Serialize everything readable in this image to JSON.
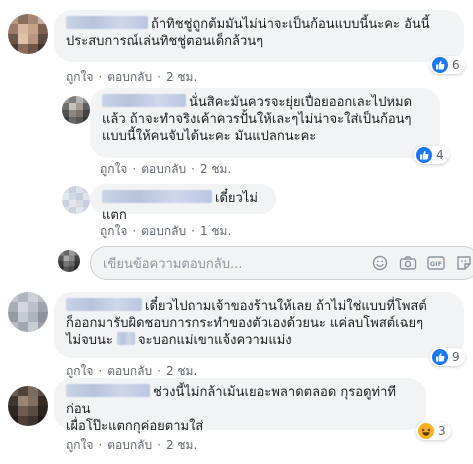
{
  "comments": [
    {
      "text": "ถ้าทิชชู่ถูกต้มมันไม่น่าจะเป็นก้อนแบบนี้นะคะ อันนี้ประสบการณ์เล่นทิชชู่ตอนเด็กล้วนๆ",
      "line1": "ถ้าทิชชู่ถูกต้มมันไม่น่าจะเป็นก้อนแบบนี้นะคะ อันนี้",
      "line2": "ประสบการณ์เล่นทิชชู่ตอนเด็กล้วนๆ",
      "like": "ถูกใจ",
      "reply": "ตอบกลับ",
      "time": "2 ชม.",
      "reaction_count": "6",
      "reaction_type": "like"
    },
    {
      "line1": "นั่นสิคะมันควรจะยุ่ยเปื่อยออกเละไปหมด",
      "line2": "แล้ว ถ้าจะทำจริงเค้าควรปั้นให้เละๆไม่น่าจะใส่เป็นก้อนๆ",
      "line3": "แบบนี้ให้คนจับได้นะคะ มันแปลกนะคะ",
      "like": "ถูกใจ",
      "reply": "ตอบกลับ",
      "time": "2 ชม.",
      "reaction_count": "4",
      "reaction_type": "like"
    },
    {
      "line1": "เดี๋ยวไม่แตก",
      "like": "ถูกใจ",
      "reply": "ตอบกลับ",
      "time": "1 ชม."
    },
    {
      "line1": "เดี๋ยวไปถามเจ้าของร้านให้เลย ถ้าไม่ใช่แบบที่โพสต์",
      "line2": "ก็ออกมารับผิดชอบการกระทำของตัวเองด้วยนะ แค่ลบโพสต์เฉยๆ",
      "line3a": "ไม่จบนะ",
      "line3b": "จะบอกแม่เขาแจ้งความแม่ง",
      "like": "ถูกใจ",
      "reply": "ตอบกลับ",
      "time": "2 ชม.",
      "reaction_count": "9",
      "reaction_type": "like"
    },
    {
      "line1": "ช่วงนี้ไม่กล้าเม้นเยอะพลาดตลอด กุรอดูท่าทีก่อน",
      "line2": "เผื่อโป๊ะแตกกุค่อยตามใส่",
      "like": "ถูกใจ",
      "reply": "ตอบกลับ",
      "time": "2 ชม.",
      "reaction_count": "3",
      "reaction_type": "haha"
    }
  ],
  "reply_box": {
    "placeholder": "เขียนข้อความตอบกลับ...",
    "icons": [
      "emoji-icon",
      "camera-icon",
      "gif-icon",
      "sticker-icon"
    ]
  },
  "colors": {
    "bubble": "#f2f3f5",
    "like_blue": "#1877f2",
    "meta_gray": "#606770"
  }
}
